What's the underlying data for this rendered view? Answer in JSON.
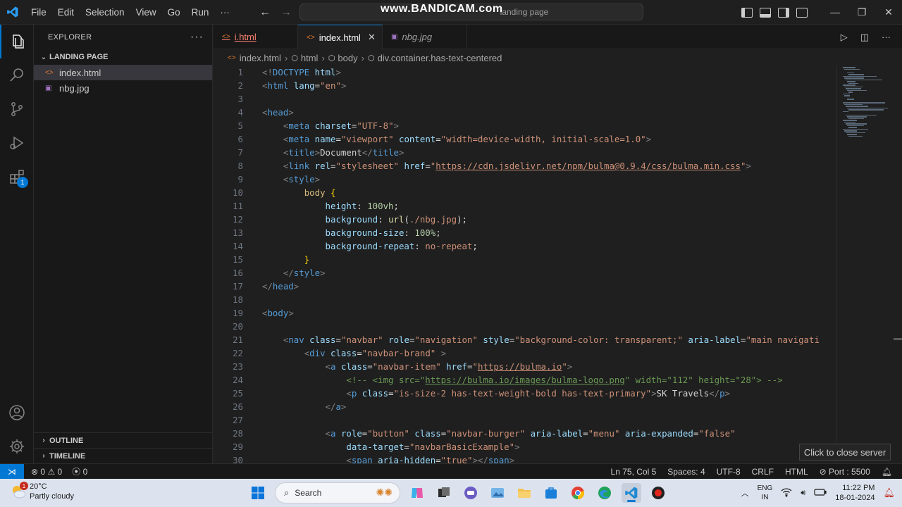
{
  "titlebar": {
    "menu": [
      "File",
      "Edit",
      "Selection",
      "View",
      "Go",
      "Run",
      "···"
    ],
    "command_center": "landing page",
    "watermark": "www.BANDICAM.com"
  },
  "sidebar": {
    "title": "EXPLORER",
    "more": "···",
    "folder": "LANDING PAGE",
    "files": [
      {
        "name": "index.html",
        "type": "html",
        "selected": true
      },
      {
        "name": "nbg.jpg",
        "type": "image",
        "selected": false
      }
    ],
    "outline": "OUTLINE",
    "timeline": "TIMELINE"
  },
  "tabs": [
    {
      "label": "i.html",
      "state": "error"
    },
    {
      "label": "index.html",
      "state": "active"
    },
    {
      "label": "nbg.jpg",
      "state": "preview"
    }
  ],
  "breadcrumb": [
    "index.html",
    "html",
    "body",
    "div.container.has-text-centered"
  ],
  "code_lines": [
    {
      "n": "1",
      "html": "<span class=\"t\">&lt;!</span><span class=\"tg\">DOCTYPE</span> <span class=\"at\">html</span><span class=\"t\">&gt;</span>"
    },
    {
      "n": "2",
      "html": "<span class=\"t\">&lt;</span><span class=\"tg\">html</span> <span class=\"at\">lang</span><span class=\"tx\">=</span><span class=\"st\">\"en\"</span><span class=\"t\">&gt;</span>"
    },
    {
      "n": "3",
      "html": ""
    },
    {
      "n": "4",
      "html": "<span class=\"t\">&lt;</span><span class=\"tg\">head</span><span class=\"t\">&gt;</span>"
    },
    {
      "n": "5",
      "html": "    <span class=\"t\">&lt;</span><span class=\"tg\">meta</span> <span class=\"at\">charset</span><span class=\"tx\">=</span><span class=\"st\">\"UTF-8\"</span><span class=\"t\">&gt;</span>"
    },
    {
      "n": "6",
      "html": "    <span class=\"t\">&lt;</span><span class=\"tg\">meta</span> <span class=\"at\">name</span><span class=\"tx\">=</span><span class=\"st\">\"viewport\"</span> <span class=\"at\">content</span><span class=\"tx\">=</span><span class=\"st\">\"width=device-width, initial-scale=1.0\"</span><span class=\"t\">&gt;</span>"
    },
    {
      "n": "7",
      "html": "    <span class=\"t\">&lt;</span><span class=\"tg\">title</span><span class=\"t\">&gt;</span><span class=\"tx\">Document</span><span class=\"t\">&lt;/</span><span class=\"tg\">title</span><span class=\"t\">&gt;</span>"
    },
    {
      "n": "8",
      "html": "    <span class=\"t\">&lt;</span><span class=\"tg\">link</span> <span class=\"at\">rel</span><span class=\"tx\">=</span><span class=\"st\">\"stylesheet\"</span> <span class=\"at\">href</span><span class=\"tx\">=</span><span class=\"st\">\"</span><span class=\"url\">https://cdn.jsdelivr.net/npm/bulma@0.9.4/css/bulma.min.css</span><span class=\"st\">\"</span><span class=\"t\">&gt;</span>"
    },
    {
      "n": "9",
      "html": "    <span class=\"t\">&lt;</span><span class=\"tg\">style</span><span class=\"t\">&gt;</span>"
    },
    {
      "n": "10",
      "html": "        <span class=\"sel\">body</span> <span class=\"br\">{</span>"
    },
    {
      "n": "11",
      "html": "            <span class=\"prop\">height</span><span class=\"tx\">: </span><span class=\"num\">100vh</span><span class=\"tx\">;</span>"
    },
    {
      "n": "12",
      "html": "            <span class=\"prop\">background</span><span class=\"tx\">: </span><span class=\"fn\">url</span><span class=\"tx\">(</span><span class=\"st\">./nbg.jpg</span><span class=\"tx\">);</span>"
    },
    {
      "n": "13",
      "html": "            <span class=\"prop\">background-size</span><span class=\"tx\">: </span><span class=\"num\">100%</span><span class=\"tx\">;</span>"
    },
    {
      "n": "14",
      "html": "            <span class=\"prop\">background-repeat</span><span class=\"tx\">: </span><span class=\"st\">no-repeat</span><span class=\"tx\">;</span>"
    },
    {
      "n": "15",
      "html": "        <span class=\"br\">}</span>"
    },
    {
      "n": "16",
      "html": "    <span class=\"t\">&lt;/</span><span class=\"tg\">style</span><span class=\"t\">&gt;</span>"
    },
    {
      "n": "17",
      "html": "<span class=\"t\">&lt;/</span><span class=\"tg\">head</span><span class=\"t\">&gt;</span>"
    },
    {
      "n": "18",
      "html": ""
    },
    {
      "n": "19",
      "html": "<span class=\"t\">&lt;</span><span class=\"tg\">body</span><span class=\"t\">&gt;</span>"
    },
    {
      "n": "20",
      "html": ""
    },
    {
      "n": "21",
      "html": "    <span class=\"t\">&lt;</span><span class=\"tg\">nav</span> <span class=\"at\">class</span><span class=\"tx\">=</span><span class=\"st\">\"navbar\"</span> <span class=\"at\">role</span><span class=\"tx\">=</span><span class=\"st\">\"navigation\"</span> <span class=\"at\">style</span><span class=\"tx\">=</span><span class=\"st\">\"background-color: transparent;\"</span> <span class=\"at\">aria-label</span><span class=\"tx\">=</span><span class=\"st\">\"main navigati</span>"
    },
    {
      "n": "22",
      "html": "        <span class=\"t\">&lt;</span><span class=\"tg\">div</span> <span class=\"at\">class</span><span class=\"tx\">=</span><span class=\"st\">\"navbar-brand\"</span> <span class=\"t\">&gt;</span>"
    },
    {
      "n": "23",
      "html": "            <span class=\"t\">&lt;</span><span class=\"tg\">a</span> <span class=\"at\">class</span><span class=\"tx\">=</span><span class=\"st\">\"navbar-item\"</span> <span class=\"at\">href</span><span class=\"tx\">=</span><span class=\"st\">\"</span><span class=\"url\">https://bulma.io</span><span class=\"st\">\"</span><span class=\"t\">&gt;</span>"
    },
    {
      "n": "24",
      "html": "                <span class=\"cm\">&lt;!-- &lt;img src=\"</span><span class=\"cm\" style=\"text-decoration:underline\">https://bulma.io/images/bulma-logo.png</span><span class=\"cm\">\" width=\"112\" height=\"28\"&gt; --&gt;</span>"
    },
    {
      "n": "25",
      "html": "                <span class=\"t\">&lt;</span><span class=\"tg\">p</span> <span class=\"at\">class</span><span class=\"tx\">=</span><span class=\"st\">\"is-size-2 has-text-weight-bold has-text-primary\"</span><span class=\"t\">&gt;</span><span class=\"tx\">SK Travels</span><span class=\"t\">&lt;/</span><span class=\"tg\">p</span><span class=\"t\">&gt;</span>"
    },
    {
      "n": "26",
      "html": "            <span class=\"t\">&lt;/</span><span class=\"tg\">a</span><span class=\"t\">&gt;</span>"
    },
    {
      "n": "27",
      "html": ""
    },
    {
      "n": "28",
      "html": "            <span class=\"t\">&lt;</span><span class=\"tg\">a</span> <span class=\"at\">role</span><span class=\"tx\">=</span><span class=\"st\">\"button\"</span> <span class=\"at\">class</span><span class=\"tx\">=</span><span class=\"st\">\"navbar-burger\"</span> <span class=\"at\">aria-label</span><span class=\"tx\">=</span><span class=\"st\">\"menu\"</span> <span class=\"at\">aria-expanded</span><span class=\"tx\">=</span><span class=\"st\">\"false\"</span>"
    },
    {
      "n": "29",
      "html": "                <span class=\"at\">data-target</span><span class=\"tx\">=</span><span class=\"st\">\"navbarBasicExample\"</span><span class=\"t\">&gt;</span>"
    },
    {
      "n": "30",
      "html": "                <span class=\"t\">&lt;</span><span class=\"tg\">span</span> <span class=\"at\">aria-hidden</span><span class=\"tx\">=</span><span class=\"st\">\"true\"</span><span class=\"t\">&gt;&lt;/</span><span class=\"tg\">span</span><span class=\"t\">&gt;</span>"
    }
  ],
  "tooltip": "Click to close server",
  "statusbar": {
    "errors": "0",
    "warnings": "0",
    "ports": "0",
    "position": "Ln 75, Col 5",
    "spaces": "Spaces: 4",
    "encoding": "UTF-8",
    "eol": "CRLF",
    "language": "HTML",
    "port": "Port : 5500"
  },
  "taskbar": {
    "weather_temp": "20°C",
    "weather_desc": "Partly cloudy",
    "weather_badge": "1",
    "search_placeholder": "Search",
    "lang_line1": "ENG",
    "lang_line2": "IN",
    "time": "11:22 PM",
    "date": "18-01-2024"
  },
  "activity_badge": "1",
  "colors": {
    "accent": "#0078d4",
    "editor_bg": "#1f1f1f",
    "sidebar_bg": "#181818",
    "taskbar_bg": "#dde3ee"
  }
}
